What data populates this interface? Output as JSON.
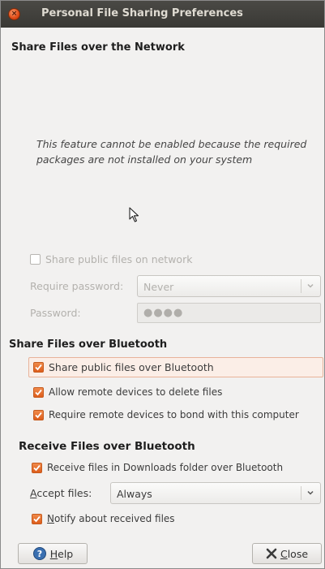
{
  "window": {
    "title": "Personal File Sharing Preferences"
  },
  "network": {
    "heading": "Share Files over the Network",
    "notice": "This feature cannot be enabled because the required packages are not installed on your system",
    "share_public": {
      "label": "Share public files on network",
      "checked": false
    },
    "require_password": {
      "label": "Require password:",
      "value": "Never"
    },
    "password": {
      "label": "Password:",
      "value": "●●●●"
    }
  },
  "bluetooth_share": {
    "heading": "Share Files over Bluetooth",
    "items": [
      {
        "label": "Share public files over Bluetooth",
        "checked": true
      },
      {
        "label": "Allow remote devices to delete files",
        "checked": true
      },
      {
        "label": "Require remote devices to bond with this computer",
        "checked": true
      }
    ]
  },
  "bluetooth_receive": {
    "heading": "Receive Files over Bluetooth",
    "receive_downloads": {
      "label": "Receive files in Downloads folder over Bluetooth",
      "checked": true
    },
    "accept_files": {
      "label": "Accept files:",
      "value": "Always"
    },
    "notify": {
      "label": "Notify about received files",
      "checked": true
    }
  },
  "buttons": {
    "help": "Help",
    "close": "Close"
  },
  "colors": {
    "titlebar": "#3c3b37",
    "accent": "#dd5d1c",
    "window_bg": "#f2f1f0"
  }
}
